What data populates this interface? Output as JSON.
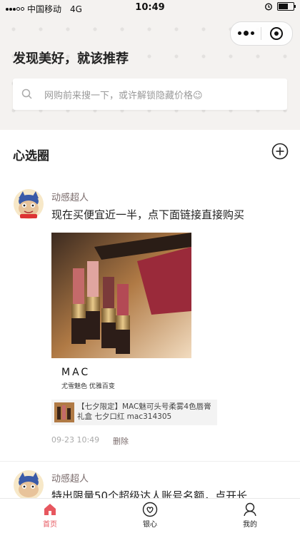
{
  "status_bar": {
    "carrier": "中国移动",
    "network": "4G",
    "time": "10:49"
  },
  "header": {
    "title": "发现美好，就该推荐",
    "search_placeholder": "网购前来搜一下，或许解锁隐藏价格😉"
  },
  "section": {
    "title": "心选圈"
  },
  "posts": [
    {
      "author": "动感超人",
      "text": "现在买便宜近一半，点下面链接直接购买",
      "image_caption_brand": "MAC",
      "image_caption_sub": "尤雪魅色 优雅百变",
      "product_title": "【七夕限定】MAC魅可头号柔雾4色唇膏礼盒 七夕口红 mac314305",
      "date": "09-23 10:49",
      "delete_label": "删除"
    },
    {
      "author": "动感超人",
      "text": "特出限量50个超级达人账号名额，点开长"
    }
  ],
  "tabbar": {
    "tabs": [
      {
        "label": "首页",
        "icon": "home-icon",
        "active": true
      },
      {
        "label": "银心",
        "icon": "heart-icon",
        "active": false
      },
      {
        "label": "我的",
        "icon": "user-icon",
        "active": false
      }
    ]
  },
  "colors": {
    "accent": "#e7575f",
    "header_bg": "#f4f2f0"
  }
}
